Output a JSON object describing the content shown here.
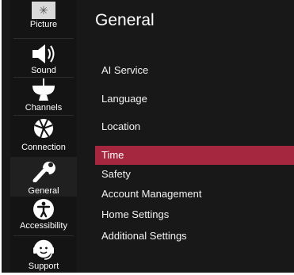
{
  "sidebar": {
    "items": [
      {
        "label": "Picture",
        "icon": "picture-icon"
      },
      {
        "label": "Sound",
        "icon": "speaker-icon"
      },
      {
        "label": "Channels",
        "icon": "satellite-dish-icon"
      },
      {
        "label": "Connection",
        "icon": "globe-icon"
      },
      {
        "label": "General",
        "icon": "wrench-icon"
      },
      {
        "label": "Accessibility",
        "icon": "accessibility-icon"
      },
      {
        "label": "Support",
        "icon": "headset-icon"
      }
    ],
    "selected": "General"
  },
  "main": {
    "title": "General",
    "items": [
      {
        "label": "AI Service"
      },
      {
        "label": "Language"
      },
      {
        "label": "Location"
      },
      {
        "label": "Time"
      },
      {
        "label": "Safety"
      },
      {
        "label": "Account Management"
      },
      {
        "label": "Home Settings"
      },
      {
        "label": "Additional Settings"
      }
    ],
    "selected": "Time"
  },
  "colors": {
    "background": "#181818",
    "highlight": "#a4263f",
    "text": "#ffffff"
  }
}
